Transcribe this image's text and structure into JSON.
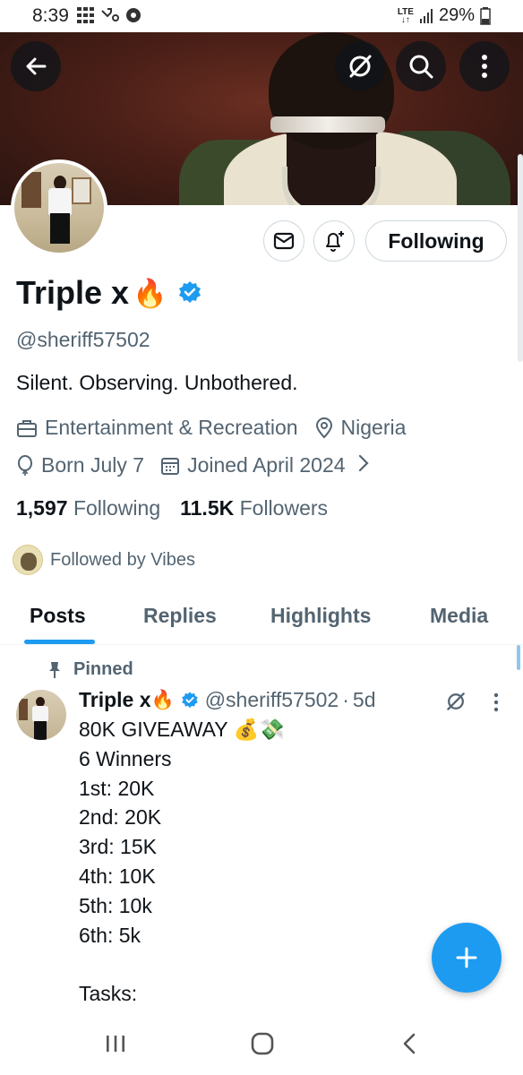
{
  "status_bar": {
    "time": "8:39",
    "network": "LTE",
    "battery": "29%"
  },
  "header": {
    "back_icon": "arrow-left-icon",
    "grok_icon": "slashed-circle-icon",
    "search_icon": "search-icon",
    "more_icon": "vertical-dots-icon"
  },
  "profile": {
    "name": "Triple x",
    "name_emoji": "🔥",
    "handle": "@sheriff57502",
    "bio": "Silent. Observing. Unbothered.",
    "category": "Entertainment & Recreation",
    "location": "Nigeria",
    "birthday": "Born July 7",
    "joined": "Joined April 2024",
    "following_count": "1,597",
    "following_label": "Following",
    "followers_count": "11.5K",
    "followers_label": "Followers",
    "followed_by": "Followed by Vibes",
    "following_button": "Following",
    "verified_color": "#1d9bf0"
  },
  "tabs": [
    {
      "label": "Posts",
      "active": true
    },
    {
      "label": "Replies",
      "active": false
    },
    {
      "label": "Highlights",
      "active": false
    },
    {
      "label": "Media",
      "active": false
    }
  ],
  "pinned_post": {
    "pinned_label": "Pinned",
    "author_name": "Triple x",
    "author_emoji": "🔥",
    "author_handle": "@sheriff57502",
    "time_sep": "·",
    "time": "5d",
    "lines": [
      "80K GIVEAWAY 💰💸",
      "6 Winners",
      "1st: 20K",
      "2nd: 20K",
      "3rd: 15K",
      "4th: 10K",
      "5th: 10k",
      "6th: 5k",
      "",
      "Tasks:"
    ]
  },
  "colors": {
    "accent": "#1d9bf0",
    "text_primary": "#0f1419",
    "text_secondary": "#536471"
  }
}
